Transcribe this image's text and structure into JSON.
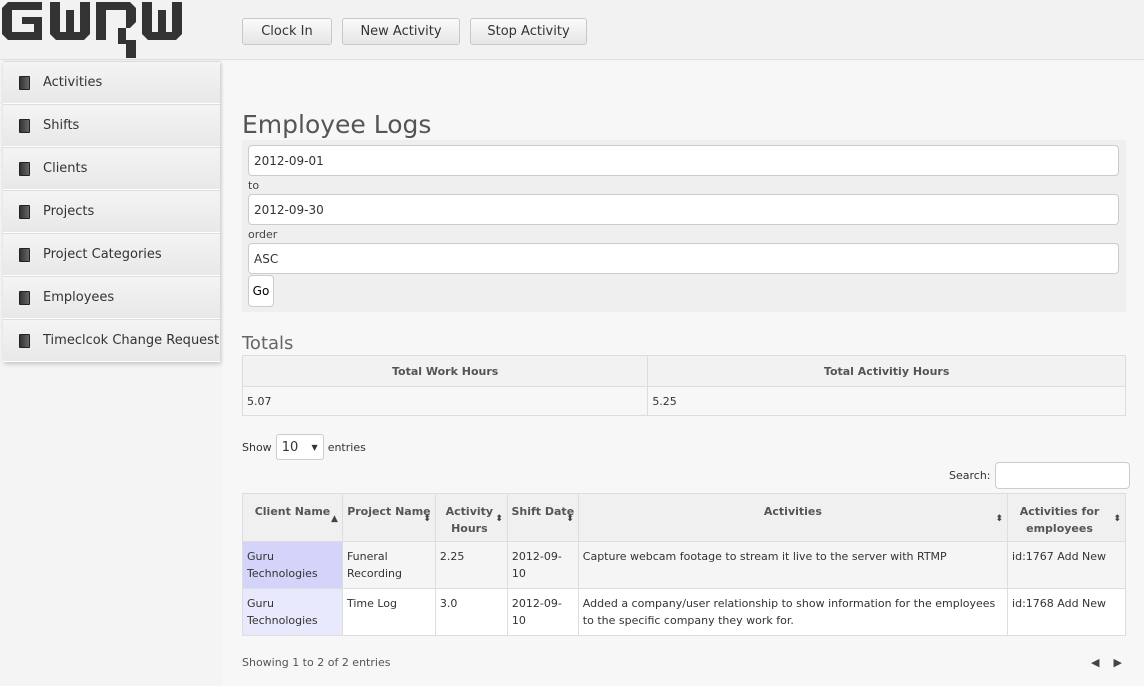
{
  "header": {
    "logo": "GURU",
    "buttons": [
      "Clock In",
      "New Activity",
      "Stop Activity"
    ]
  },
  "sidebar": {
    "items": [
      {
        "label": "Activities"
      },
      {
        "label": "Shifts"
      },
      {
        "label": "Clients"
      },
      {
        "label": "Projects"
      },
      {
        "label": "Project Categories"
      },
      {
        "label": "Employees"
      },
      {
        "label": "Timeclcok Change Request"
      }
    ]
  },
  "page": {
    "title": "Employee Logs"
  },
  "form": {
    "from": "2012-09-01",
    "to_label": "to",
    "to": "2012-09-30",
    "order_label": "order",
    "order": "ASC",
    "go": "Go"
  },
  "totals": {
    "title": "Totals",
    "headers": [
      "Total Work Hours",
      "Total Activitiy Hours"
    ],
    "values": [
      "5.07",
      "5.25"
    ]
  },
  "table_controls": {
    "show": "Show",
    "entries_value": "10",
    "entries": "entries",
    "search_label": "Search:"
  },
  "table": {
    "headers": [
      "Client Name",
      "Project Name",
      "Activity Hours",
      "Shift Date",
      "Activities",
      "Activities for employees"
    ],
    "rows": [
      [
        "Guru Technologies",
        "Funeral Recording",
        "2.25",
        "2012-09-10",
        "Capture webcam footage to stream it live to the server with RTMP",
        "id:1767 Add New"
      ],
      [
        "Guru Technologies",
        "Time Log",
        "3.0",
        "2012-09-10",
        "Added a company/user relationship to show information for the employees to the specific company they work for.",
        "id:1768 Add New"
      ]
    ]
  },
  "footer": {
    "info": "Showing 1 to 2 of 2 entries"
  }
}
